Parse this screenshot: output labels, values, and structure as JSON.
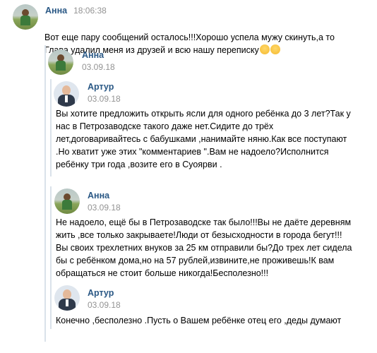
{
  "messages": {
    "m1": {
      "author": "Анна",
      "time": "18:06:38",
      "text": "Вот еще пару сообщений осталось!!!Хорошо успела мужу скинуть,а то\nГлава удалил меня из друзей и всю нашу переписку",
      "emoji": [
        "smiling-face-emoji",
        "flushed-face-emoji"
      ]
    },
    "f1": {
      "author": "Анна",
      "date": "03.09.18"
    },
    "f2": {
      "author": "Артур",
      "date": "03.09.18",
      "text": "Вы хотите предложить открыть ясли для одного ребёнка до 3 лет?Так у\nнас в Петрозаводске такого даже нет.Сидите до трёх\nлет,договаривайтесь с бабушками ,нанимайте няню.Как все поступают\n.Но хватит уже этих \"комментариев \".Вам не надоело?Исполнится\nребёнку три года ,возите его в Суоярви ."
    },
    "f3": {
      "author": "Анна",
      "date": "03.09.18",
      "text": "Не надоело, ещё бы в Петрозаводске так было!!!Вы не даёте деревням\nжить ,все только закрываете!Люди от безысходности в города бегут!!!\nВы своих трехлетних внуков за 25 км отправили бы?До трех лет сидела\nбы с ребёнком дома,но на 57 рублей,извините,не проживешь!К вам\nобращаться не стоит больше никогда!Бесполезно!!!"
    },
    "f4": {
      "author": "Артур",
      "date": "03.09.18",
      "text": "Конечно ,бесполезно .Пусть о Вашем ребёнке отец его ,деды думают"
    }
  },
  "colors": {
    "name": "#2a5885",
    "time": "#939393",
    "bar": "#dae2ea"
  }
}
